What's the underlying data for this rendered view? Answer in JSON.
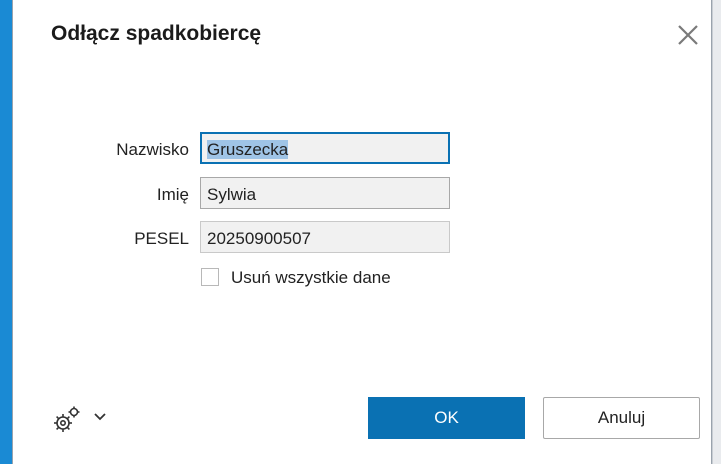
{
  "dialog": {
    "title": "Odłącz spadkobiercę",
    "close_icon": "close-icon"
  },
  "form": {
    "surname_label": "Nazwisko",
    "surname_value": "Gruszecka",
    "firstname_label": "Imię",
    "firstname_value": "Sylwia",
    "pesel_label": "PESEL",
    "pesel_value": "20250900507",
    "delete_all_label": "Usuń wszystkie dane",
    "delete_all_checked": false
  },
  "footer": {
    "settings_icon": "gears-icon",
    "dropdown_icon": "chevron-down-icon",
    "ok_label": "OK",
    "cancel_label": "Anuluj"
  },
  "colors": {
    "accent": "#0a71b3",
    "selection": "#9fc4e6",
    "window_edge": "#1a8ad4"
  }
}
